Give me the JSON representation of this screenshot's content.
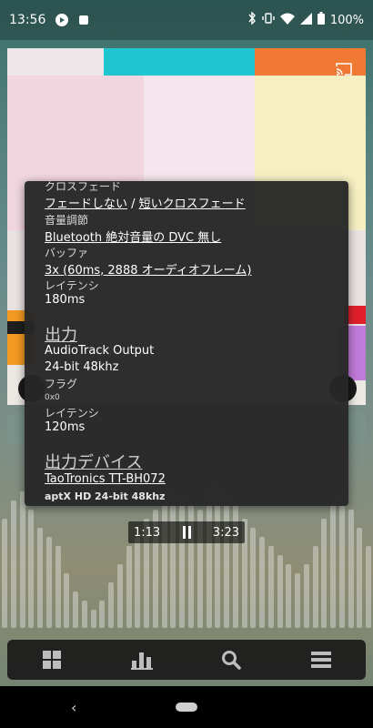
{
  "status": {
    "time": "13:56",
    "battery": "100%",
    "icons": [
      "play-icon",
      "stop-square-icon",
      "bluetooth-icon",
      "vibrate-icon",
      "wifi-icon",
      "signal-icon",
      "battery-icon"
    ]
  },
  "popup": {
    "crossfade_label": "クロスフェード",
    "crossfade_opt1": "フェードしない",
    "crossfade_sep": " / ",
    "crossfade_opt2": "短いクロスフェード",
    "volume_label": "音量調節",
    "volume_value": "Bluetooth 絶対音量の DVC 無し",
    "buffer_label": "バッファ",
    "buffer_value": "3x (60ms, 2888 オーディオフレーム)",
    "latency_label": "レイテンシ",
    "latency_value": "180ms",
    "output_heading": "出力",
    "output_name": "AudioTrack Output",
    "output_format": "24-bit 48khz",
    "flags_label": "フラグ",
    "flags_value": "0x0",
    "output_latency_label": "レイテンシ",
    "output_latency_value": "120ms",
    "device_heading": "出力デバイス",
    "device_name": "TaoTronics TT-BH072",
    "device_codec": "aptX HD 24-bit 48khz"
  },
  "player": {
    "elapsed": "1:13",
    "total": "3:23"
  },
  "bottom_nav": [
    "grid-icon",
    "bar-chart-icon",
    "search-icon",
    "menu-icon"
  ],
  "colors": {
    "popup_bg": "#262626",
    "accent_cyan": "#1fc6cf",
    "accent_orange": "#f07a34"
  }
}
